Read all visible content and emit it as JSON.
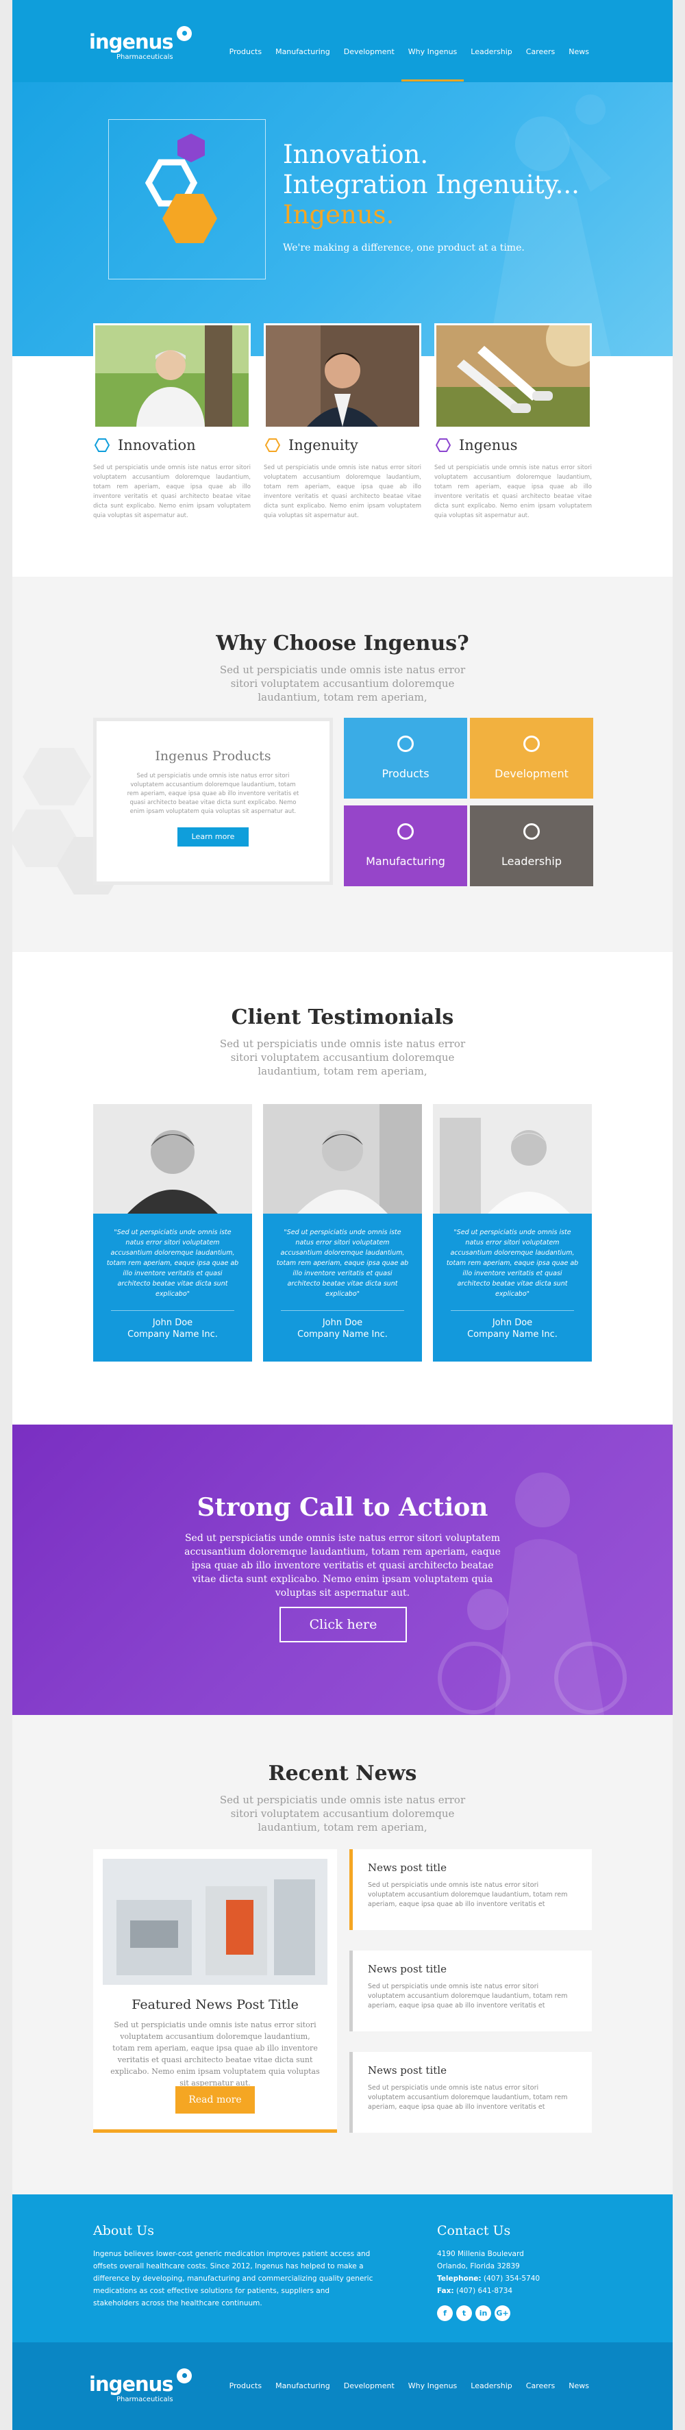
{
  "brand": {
    "name": "ingenus",
    "subname": "Pharmaceuticals",
    "colors": {
      "primary": "#0f9edb",
      "accent": "#f5a623",
      "purple": "#8b45cf"
    }
  },
  "nav": {
    "items": [
      "Products",
      "Manufacturing",
      "Development",
      "Why Ingenus",
      "Leadership",
      "Careers",
      "News"
    ],
    "active": "Why Ingenus"
  },
  "hero": {
    "line1": "Innovation.",
    "line2": "Integration Ingenuity...",
    "line3": "Ingenus.",
    "subtitle": "We're making a difference, one product at a time."
  },
  "features": [
    {
      "title": "Innovation",
      "icon": "hexagon-blue-icon",
      "body": "Sed ut perspiciatis unde omnis iste natus error sitori voluptatem accusantium doloremque laudantium, totam rem aperiam, eaque ipsa quae ab illo inventore veritatis et quasi architecto beatae vitae dicta sunt explicabo. Nemo enim ipsam voluptatem quia voluptas sit aspernatur aut."
    },
    {
      "title": "Ingenuity",
      "icon": "hexagon-orange-icon",
      "body": "Sed ut perspiciatis unde omnis iste natus error sitori voluptatem accusantium doloremque laudantium, totam rem aperiam, eaque ipsa quae ab illo inventore veritatis et quasi architecto beatae vitae dicta sunt explicabo. Nemo enim ipsam voluptatem quia voluptas sit aspernatur aut."
    },
    {
      "title": "Ingenus",
      "icon": "hexagon-purple-icon",
      "body": "Sed ut perspiciatis unde omnis iste natus error sitori voluptatem accusantium doloremque laudantium, totam rem aperiam, eaque ipsa quae ab illo inventore veritatis et quasi architecto beatae vitae dicta sunt explicabo. Nemo enim ipsam voluptatem quia voluptas sit aspernatur aut."
    }
  ],
  "why": {
    "title": "Why Choose Ingenus?",
    "subtitle": "Sed ut perspiciatis unde omnis iste natus error sitori voluptatem accusantium doloremque laudantium, totam rem aperiam,",
    "card_title": "Ingenus Products",
    "card_body": "Sed ut perspiciatis unde omnis iste natus error sitori voluptatem accusantium doloremque laudantium, totam rem aperiam, eaque ipsa quae ab illo inventore veritatis et quasi architecto beatae vitae dicta sunt explicabo. Nemo enim ipsam voluptatem quia voluptas sit aspernatur aut.",
    "card_button": "Learn more",
    "tiles": [
      "Products",
      "Development",
      "Manufacturing",
      "Leadership"
    ]
  },
  "testimonials": {
    "title": "Client Testimonials",
    "subtitle": "Sed ut perspiciatis unde omnis iste natus error sitori voluptatem accusantium doloremque laudantium, totam rem aperiam,",
    "items": [
      {
        "quote": "\"Sed ut perspiciatis unde omnis iste natus error sitori voluptatem accusantium doloremque laudantium, totam rem aperiam, eaque ipsa quae ab illo inventore veritatis et quasi architecto beatae vitae dicta sunt explicabo\"",
        "name": "John Doe",
        "company": "Company Name Inc."
      },
      {
        "quote": "\"Sed ut perspiciatis unde omnis iste natus error sitori voluptatem accusantium doloremque laudantium, totam rem aperiam, eaque ipsa quae ab illo inventore veritatis et quasi architecto beatae vitae dicta sunt explicabo\"",
        "name": "John Doe",
        "company": "Company Name Inc."
      },
      {
        "quote": "\"Sed ut perspiciatis unde omnis iste natus error sitori voluptatem accusantium doloremque laudantium, totam rem aperiam, eaque ipsa quae ab illo inventore veritatis et quasi architecto beatae vitae dicta sunt explicabo\"",
        "name": "John Doe",
        "company": "Company Name Inc."
      }
    ]
  },
  "cta": {
    "title": "Strong Call to Action",
    "body": "Sed ut perspiciatis unde omnis iste natus error sitori voluptatem accusantium doloremque laudantium, totam rem aperiam, eaque ipsa quae ab illo inventore veritatis et quasi architecto beatae vitae dicta sunt explicabo. Nemo enim ipsam voluptatem quia voluptas sit aspernatur aut.",
    "button": "Click here"
  },
  "news": {
    "title": "Recent News",
    "subtitle": "Sed ut perspiciatis unde omnis iste natus error sitori voluptatem accusantium doloremque laudantium, totam rem aperiam,",
    "featured_title": "Featured News Post Title",
    "featured_body": "Sed ut perspiciatis unde omnis iste natus error sitori voluptatem accusantium doloremque laudantium, totam rem aperiam, eaque ipsa quae ab illo inventore veritatis et quasi architecto beatae vitae dicta sunt explicabo. Nemo enim ipsam voluptatem quia voluptas sit aspernatur aut.",
    "featured_button": "Read more",
    "posts": [
      {
        "title": "News post title",
        "body": "Sed ut perspiciatis unde omnis iste natus error sitori voluptatem accusantium doloremque laudantium, totam rem aperiam, eaque ipsa quae ab illo inventore veritatis et"
      },
      {
        "title": "News post title",
        "body": "Sed ut perspiciatis unde omnis iste natus error sitori voluptatem accusantium doloremque laudantium, totam rem aperiam, eaque ipsa quae ab illo inventore veritatis et"
      },
      {
        "title": "News post title",
        "body": "Sed ut perspiciatis unde omnis iste natus error sitori voluptatem accusantium doloremque laudantium, totam rem aperiam, eaque ipsa quae ab illo inventore veritatis et"
      }
    ]
  },
  "footer": {
    "about_title": "About Us",
    "about_body": "Ingenus believes lower-cost generic medication improves patient access and offsets overall healthcare costs. Since 2012, Ingenus has helped to make a difference by developing, manufacturing and commercializing quality generic medications as cost effective solutions for patients, suppliers and stakeholders across the healthcare continuum.",
    "contact_title": "Contact Us",
    "address1": "4190 Millenia Boulevard",
    "address2": "Orlando, Florida 32839",
    "telephone_label": "Telephone:",
    "telephone": "(407) 354-5740",
    "fax_label": "Fax:",
    "fax": "(407) 641-8734",
    "social": [
      "f",
      "t",
      "in",
      "G+"
    ]
  }
}
